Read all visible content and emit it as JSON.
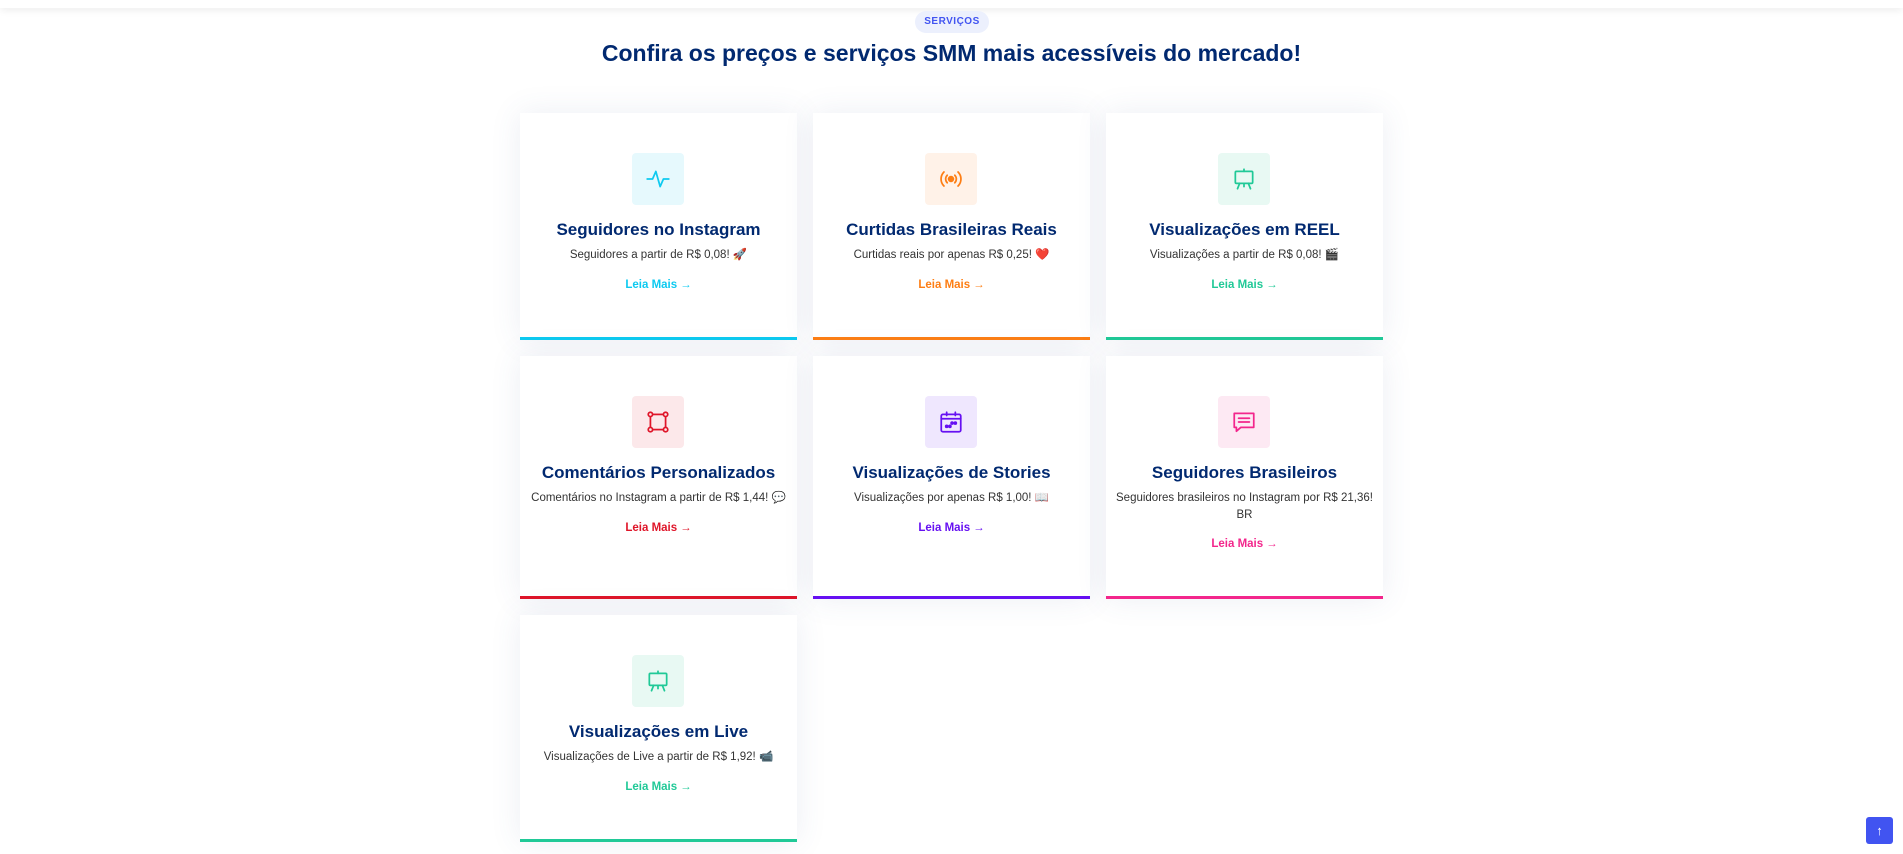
{
  "section": {
    "badge": "SERVIÇOS",
    "title": "Confira os preços e serviços SMM mais acessíveis do mercado!"
  },
  "colors": {
    "title": "#012970",
    "cyan": "#0dcaf0",
    "orange": "#fd7e14",
    "green": "#20c997",
    "red": "#df1529",
    "indigo": "#6610f2",
    "pink": "#f3268c",
    "accent": "#4154f1"
  },
  "cards": [
    {
      "title": "Seguidores no Instagram",
      "text": "Seguidores a partir de R$ 0,08! 🚀",
      "link": "Leia Mais",
      "icon": "activity-icon",
      "color": "cyan"
    },
    {
      "title": "Curtidas Brasileiras Reais",
      "text": "Curtidas reais por apenas R$ 0,25! ❤️",
      "link": "Leia Mais",
      "icon": "broadcast-icon",
      "color": "orange"
    },
    {
      "title": "Visualizações em REEL",
      "text": "Visualizações a partir de R$ 0,08! 🎬",
      "link": "Leia Mais",
      "icon": "easel-icon",
      "color": "green"
    },
    {
      "title": "Comentários Personalizados",
      "text": "Comentários no Instagram a partir de R$ 1,44! 💬",
      "link": "Leia Mais",
      "icon": "bounding-box-icon",
      "color": "red"
    },
    {
      "title": "Visualizações de Stories",
      "text": "Visualizações por apenas R$ 1,00! 📖",
      "link": "Leia Mais",
      "icon": "calendar-icon",
      "color": "indigo"
    },
    {
      "title": "Seguidores Brasileiros",
      "text": "Seguidores brasileiros no Instagram por R$ 21,36! BR",
      "link": "Leia Mais",
      "icon": "chat-icon",
      "color": "pink"
    },
    {
      "title": "Visualizações em Live",
      "text": "Visualizações de Live a partir de R$ 1,92! 📹",
      "link": "Leia Mais",
      "icon": "easel-icon",
      "color": "green"
    }
  ],
  "back_to_top": {
    "icon": "arrow-up-icon",
    "label": "↑"
  }
}
